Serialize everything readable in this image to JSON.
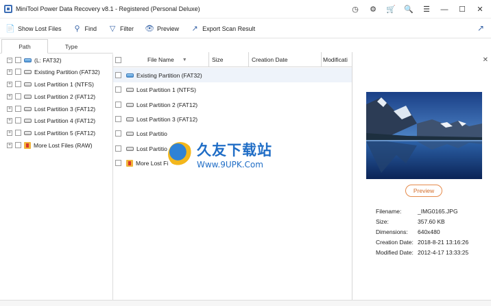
{
  "app": {
    "title": "MiniTool Power Data Recovery v8.1 - Registered (Personal Deluxe)",
    "title_icons": [
      "timer-icon",
      "support-icon",
      "cart-icon",
      "key-icon",
      "menu-icon",
      "minimize-icon",
      "maximize-icon",
      "close-icon"
    ]
  },
  "toolbar": {
    "show_lost_files": "Show Lost Files",
    "find": "Find",
    "filter": "Filter",
    "preview": "Preview",
    "export_scan_result": "Export Scan Result"
  },
  "tabs": {
    "path": "Path",
    "type": "Type"
  },
  "tree": {
    "root": "(L: FAT32)",
    "items": [
      {
        "label": "Existing Partition (FAT32)"
      },
      {
        "label": "Lost Partition 1 (NTFS)"
      },
      {
        "label": "Lost Partition 2 (FAT12)"
      },
      {
        "label": "Lost Partition 3 (FAT12)"
      },
      {
        "label": "Lost Partition 4 (FAT12)"
      },
      {
        "label": "Lost Partition 5 (FAT12)"
      },
      {
        "label": "More Lost Files (RAW)"
      }
    ]
  },
  "filelist": {
    "columns": {
      "name": "File Name",
      "size": "Size",
      "created": "Creation Date",
      "modified": "Modificati"
    },
    "rows": [
      {
        "name": "Existing Partition (FAT32)"
      },
      {
        "name": "Lost Partition 1 (NTFS)"
      },
      {
        "name": "Lost Partition 2 (FAT12)"
      },
      {
        "name": "Lost Partition 3 (FAT12)"
      },
      {
        "name": "Lost Partitio"
      },
      {
        "name": "Lost Partitio"
      },
      {
        "name": "More Lost Fi"
      }
    ]
  },
  "watermark": {
    "main": "久友下载站",
    "sub": "Www.9UPK.Com"
  },
  "preview": {
    "button": "Preview",
    "info": [
      {
        "key": "Filename:",
        "value": "_IMG0165.JPG"
      },
      {
        "key": "Size:",
        "value": "357.60 KB"
      },
      {
        "key": "Dimensions:",
        "value": "640x480"
      },
      {
        "key": "Creation Date:",
        "value": "2018-8-21 13:16:26"
      },
      {
        "key": "Modified Date:",
        "value": "2012-4-17 13:33:25"
      }
    ]
  },
  "colors": {
    "accent": "#3a66a8",
    "preview_button": "#e58a4a",
    "selected_row": "#eef3fa"
  }
}
